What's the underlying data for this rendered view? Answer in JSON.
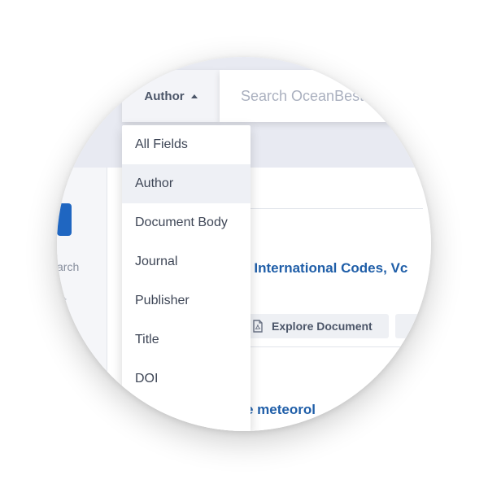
{
  "search": {
    "field_selector_label": "Author",
    "placeholder": "Search OceanBest"
  },
  "dropdown": {
    "selected": "Author",
    "items": [
      {
        "label": "All Fields"
      },
      {
        "label": "Author"
      },
      {
        "label": "Document Body"
      },
      {
        "label": "Journal"
      },
      {
        "label": "Publisher"
      },
      {
        "label": "Title"
      },
      {
        "label": "DOI"
      }
    ]
  },
  "sidebar": {
    "links": [
      "arch",
      "nt"
    ]
  },
  "results": [
    {
      "title": "- International Codes, Vc",
      "explore_label": "Explore Document"
    },
    {
      "title": "e meteorol"
    }
  ],
  "colors": {
    "accent": "#1f66c1",
    "link": "#1f5ea8",
    "band": "#e8eaf2"
  },
  "icons": {
    "field_caret": "caret-up-icon",
    "explore": "pdf-document-icon"
  }
}
